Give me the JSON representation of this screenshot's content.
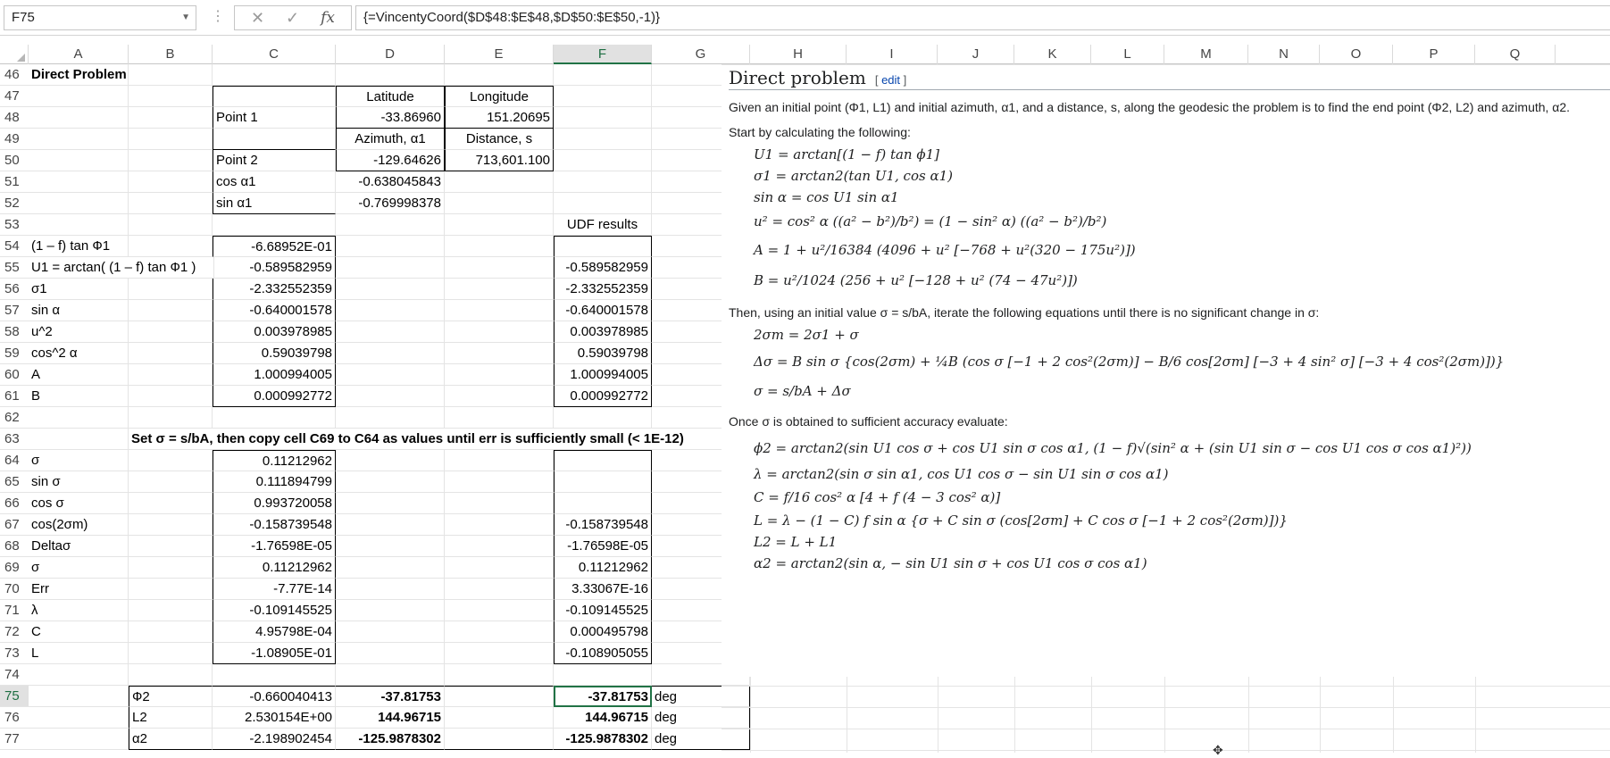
{
  "namebox": "F75",
  "formula": "{=VincentyCoord($D$48:$E$48,$D$50:$E$50,-1)}",
  "columns": [
    "A",
    "B",
    "C",
    "D",
    "E",
    "F",
    "G",
    "H",
    "I",
    "J",
    "K",
    "L",
    "M",
    "N",
    "O",
    "P",
    "Q"
  ],
  "selected_column": "F",
  "selected_row": "75",
  "rows": [
    {
      "n": "46",
      "A": "Direct Problem"
    },
    {
      "n": "47",
      "D": "Latitude",
      "E": "Longitude"
    },
    {
      "n": "48",
      "C": "Point 1",
      "D": "-33.86960",
      "E": "151.20695"
    },
    {
      "n": "49",
      "D": "Azimuth, α1",
      "E": "Distance, s"
    },
    {
      "n": "50",
      "C": "Point 2",
      "D": "-129.64626",
      "E": "713,601.100"
    },
    {
      "n": "51",
      "C": "cos α1",
      "D": "-0.638045843"
    },
    {
      "n": "52",
      "C": "sin α1",
      "D": "-0.769998378"
    },
    {
      "n": "53",
      "F": "UDF results"
    },
    {
      "n": "54",
      "A": " (1 – f) tan Ф1",
      "C": "-6.68952E-01"
    },
    {
      "n": "55",
      "A": "U1 = arctan( (1 – f) tan Ф1 )",
      "C": "-0.589582959",
      "F": "-0.589582959"
    },
    {
      "n": "56",
      "A": "σ1",
      "C": "-2.332552359",
      "F": "-2.332552359"
    },
    {
      "n": "57",
      "A": "sin α",
      "C": "-0.640001578",
      "F": "-0.640001578"
    },
    {
      "n": "58",
      "A": "u^2",
      "C": "0.003978985",
      "F": "0.003978985"
    },
    {
      "n": "59",
      "A": "cos^2 α",
      "C": "0.59039798",
      "F": "0.59039798"
    },
    {
      "n": "60",
      "A": "A",
      "C": "1.000994005",
      "F": "1.000994005"
    },
    {
      "n": "61",
      "A": "B",
      "C": "0.000992772",
      "F": "0.000992772"
    },
    {
      "n": "62"
    },
    {
      "n": "63",
      "B": "Set σ = s/bA, then copy cell C69 to C64 as values until err is sufficiently small (< 1E-12)"
    },
    {
      "n": "64",
      "A": "σ",
      "C": "0.11212962"
    },
    {
      "n": "65",
      "A": "sin σ",
      "C": "0.111894799"
    },
    {
      "n": "66",
      "A": "cos σ",
      "C": "0.993720058"
    },
    {
      "n": "67",
      "A": "cos(2σm)",
      "C": "-0.158739548",
      "F": "-0.158739548"
    },
    {
      "n": "68",
      "A": "Deltaσ",
      "C": "-1.76598E-05",
      "F": "-1.76598E-05"
    },
    {
      "n": "69",
      "A": "σ",
      "C": "0.11212962",
      "F": "0.11212962"
    },
    {
      "n": "70",
      "A": "Err",
      "C": "-7.77E-14",
      "F": "3.33067E-16"
    },
    {
      "n": "71",
      "A": "λ",
      "C": "-0.109145525",
      "F": "-0.109145525"
    },
    {
      "n": "72",
      "A": "C",
      "C": "4.95798E-04",
      "F": "0.000495798"
    },
    {
      "n": "73",
      "A": "L",
      "C": "-1.08905E-01",
      "F": "-0.108905055"
    },
    {
      "n": "74"
    },
    {
      "n": "75",
      "B": "Ф2",
      "C": "-0.660040413",
      "D": "-37.81753",
      "F": "-37.81753",
      "G": "deg"
    },
    {
      "n": "76",
      "B": "L2",
      "C": "2.530154E+00",
      "D": "144.96715",
      "F": "144.96715",
      "G": "deg"
    },
    {
      "n": "77",
      "B": "α2",
      "C": "-2.198902454",
      "D": "-125.9878302",
      "F": "-125.9878302",
      "G": "deg"
    }
  ],
  "wiki": {
    "title": "Direct problem",
    "edit": "edit",
    "intro": "Given an initial point (Φ1, L1) and initial azimuth, α1, and a distance, s, along the geodesic the problem is to find the end point (Φ2, L2) and azimuth, α2.",
    "start": "Start by calculating the following:",
    "eq1": "U1 = arctan[(1 − f) tan ϕ1]",
    "eq2": "σ1 = arctan2(tan U1, cos α1)",
    "eq3": "sin α = cos U1 sin α1",
    "eq4": "u² = cos² α ((a² − b²)/b²) = (1 − sin² α) ((a² − b²)/b²)",
    "eq5": "A = 1 + u²/16384 (4096 + u² [−768 + u²(320 − 175u²)])",
    "eq6": "B = u²/1024 (256 + u² [−128 + u² (74 − 47u²)])",
    "then": "Then, using an initial value σ = s/bA, iterate the following equations until there is no significant change in σ:",
    "eq7": "2σm = 2σ1 + σ",
    "eq8": "Δσ = B sin σ {cos(2σm) + ¼B (cos σ [−1 + 2 cos²(2σm)] − B/6 cos[2σm] [−3 + 4 sin² σ] [−3 + 4 cos²(2σm)])}",
    "eq9": "σ = s/bA + Δσ",
    "once": "Once σ is obtained to sufficient accuracy evaluate:",
    "eq10": "ϕ2 = arctan2(sin U1 cos σ + cos U1 sin σ cos α1, (1 − f)√(sin² α + (sin U1 sin σ − cos U1 cos σ cos α1)²))",
    "eq11": "λ = arctan2(sin σ sin α1, cos U1 cos σ − sin U1 sin σ cos α1)",
    "eq12": "C = f/16 cos² α [4 + f (4 − 3 cos² α)]",
    "eq13": "L = λ − (1 − C) f sin α {σ + C sin σ (cos[2σm] + C cos σ [−1 + 2 cos²(2σm)])}",
    "eq14": "L2 = L + L1",
    "eq15": "α2 = arctan2(sin α, − sin U1 sin σ + cos U1 cos σ cos α1)"
  }
}
